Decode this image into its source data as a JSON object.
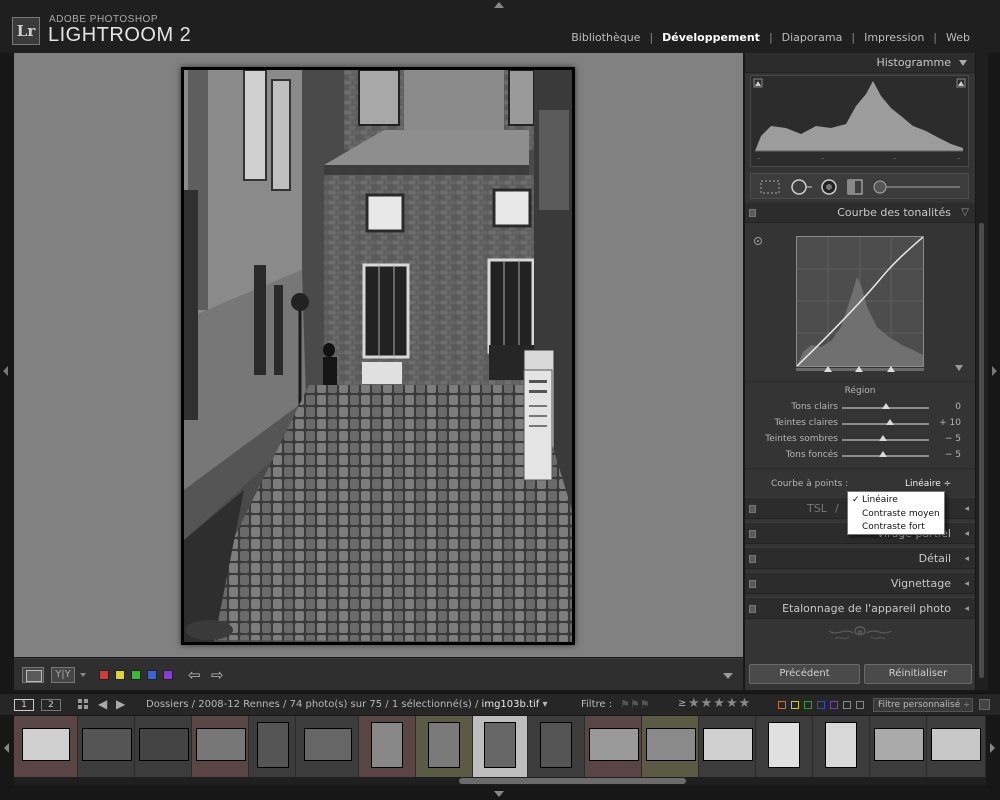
{
  "app": {
    "brand_top": "ADOBE PHOTOSHOP",
    "brand_name": "LIGHTROOM 2",
    "logo_text": "Lr"
  },
  "modules": [
    {
      "label": "Bibliothèque",
      "active": false
    },
    {
      "label": "Développement",
      "active": true
    },
    {
      "label": "Diaporama",
      "active": false
    },
    {
      "label": "Impression",
      "active": false
    },
    {
      "label": "Web",
      "active": false
    }
  ],
  "right_panel": {
    "histogram_title": "Histogramme",
    "tone_curve_title": "Courbe des tonalités",
    "region_label": "Région",
    "sliders": [
      {
        "label": "Tons clairs",
        "value": "0",
        "level": 0.5
      },
      {
        "label": "Teintes claires",
        "value": "+ 10",
        "level": 0.55
      },
      {
        "label": "Teintes sombres",
        "value": "− 5",
        "level": 0.47
      },
      {
        "label": "Tons foncés",
        "value": "− 5",
        "level": 0.47
      }
    ],
    "point_curve_label": "Courbe à points :",
    "point_curve_value": "Linéaire ÷",
    "dropdown_options": [
      "Linéaire",
      "Contraste moyen",
      "Contraste fort"
    ],
    "dropdown_check": "✓",
    "lower_panels": [
      "TSL / Couleur / N&B",
      "Virage partiel",
      "Détail",
      "Vignettage",
      "Etalonnage de l'appareil photo"
    ],
    "lower_panel_partial_left": "TSL",
    "lower_panel_partial_right": "is",
    "previous_button": "Précédent",
    "reset_button": "Réinitialiser"
  },
  "filmbar": {
    "view1": "1",
    "view2": "2",
    "path_text": "Dossiers / 2008-12 Rennes / 74 photo(s) sur 75 / 1 sélectionné(s) /",
    "current_file": "img103b.tif",
    "file_caret": "▾",
    "filter_label": "Filtre :",
    "stars_prefix": "≥",
    "stars": "★★★★★",
    "custom_filter": "Filtre personnalisé",
    "custom_filter_caret": "÷"
  },
  "colors": {
    "labels": [
      "#d23a3a",
      "#e0d23a",
      "#3ab83a",
      "#3a64d2",
      "#8a3ad2"
    ]
  },
  "toolbar": {
    "compare_text": "Y|Y",
    "back_arrow": "⇦",
    "forward_arrow": "⇨"
  }
}
